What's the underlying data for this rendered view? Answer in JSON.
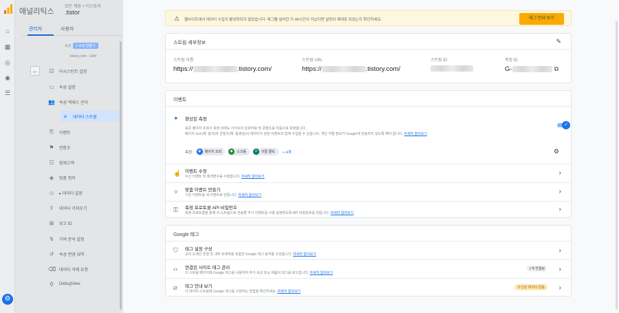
{
  "app": {
    "name": "애널리틱스",
    "account_label": "모든 계정 > 티스토리",
    "property_name": ".tistor"
  },
  "sidebar": {
    "tabs": [
      "관리자",
      "사용자"
    ],
    "create_button": "+ 속성 만들기",
    "property_label": "속성",
    "property_value": "tistory.com - GA4",
    "items": [
      {
        "label": "어시스턴트 설정",
        "icon": "checkbox-icon"
      },
      {
        "label": "속성 설정",
        "icon": "square-icon"
      },
      {
        "label": "속성 액세스 관리",
        "icon": "people-icon"
      },
      {
        "label": "데이터 스트림",
        "icon": "stream-icon",
        "active": true
      },
      {
        "label": "이벤트",
        "icon": "event-icon"
      },
      {
        "label": "전환수",
        "icon": "flag-icon"
      },
      {
        "label": "잠재고객",
        "icon": "audience-icon"
      },
      {
        "label": "맞춤 정의",
        "icon": "custom-icon"
      },
      {
        "label": "▸ 데이터 설정",
        "icon": "layers-icon"
      },
      {
        "label": "데이터 가져오기",
        "icon": "upload-icon"
      },
      {
        "label": "보고 ID",
        "icon": "id-icon"
      },
      {
        "label": "기여 분석 설정",
        "icon": "attribution-icon"
      },
      {
        "label": "속성 변경 내역",
        "icon": "history-icon"
      },
      {
        "label": "데이터 삭제 요청",
        "icon": "delete-icon"
      },
      {
        "label": "DebugView",
        "icon": "debug-icon"
      }
    ]
  },
  "banner": {
    "text": "웹사이트에서 데이터 수집이 활성화되지 않았습니다. 태그를 설치한 지 48시간이 지났다면 설정이 제대로 되었는지 확인하세요.",
    "button": "태그 안내 보기"
  },
  "stream_details": {
    "title": "스트림 세부정보",
    "fields": [
      {
        "key": "스트림 이름",
        "prefix": "https://",
        "suffix": ".tistory.com/"
      },
      {
        "key": "스트림 URL",
        "prefix": "https://",
        "suffix": ".tistory.com/"
      },
      {
        "key": "스트림 ID",
        "prefix": "",
        "suffix": ""
      },
      {
        "key": "측정 ID",
        "prefix": "G-",
        "suffix": ""
      }
    ]
  },
  "events": {
    "title": "이벤트",
    "enhanced": {
      "title": "향상된 측정",
      "desc1": "표준 페이지 조회수 측정 외에도 사이트의 상호작용 및 콘텐츠를 자동으로 측정합니다.",
      "desc2": "페이지 요소(예: 링크)와 콘텐츠(예: 동영상)의 데이터가 관련 이벤트와 함께 수집될 수 있습니다. 개인 식별 정보가 Google에 전송되지 않도록 해야 합니다.",
      "link": "자세히 알아보기",
      "measure_label": "측정:",
      "chips": [
        "페이지 조회",
        "스크롤",
        "이탈 클릭"
      ],
      "more": "+ 4개"
    },
    "rows": [
      {
        "title": "이벤트 수정",
        "desc": "수신 이벤트 및 매개변수를 수정합니다.",
        "link": "자세히 알아보기"
      },
      {
        "title": "맞춤 이벤트 만들기",
        "desc": "기존 이벤트를 새 이벤트로 만듭니다.",
        "link": "자세히 알아보기"
      },
      {
        "title": "측정 프로토콜 API 비밀번호",
        "desc": "측정 프로토콜을 통해 이 스트림으로 전송할 추가 이벤트를 사용 설정하도록 API 비밀번호를 만듭니다.",
        "link": "자세히 알아보기"
      }
    ]
  },
  "google_tag": {
    "title": "Google 태그",
    "rows": [
      {
        "title": "태그 설정 구성",
        "desc": "교차 도메인 연결 및 내부 트래픽을 포함한 Google 태그 동작을 구성합니다.",
        "link": "자세히 알아보기",
        "badge": ""
      },
      {
        "title": "연결된 사이트 태그 관리",
        "desc": "이 스트림 페이지에 Google 태그를 사용하여 추가 속성 또는 제품의 태그를 로드합니다.",
        "link": "자세히 알아보기",
        "badge": "1개 연결됨"
      },
      {
        "title": "태그 안내 보기",
        "desc": "이 데이터 스트림에 Google 태그를 구현하는 방법을 확인하세요.",
        "link": "자세히 알아보기",
        "badge": "수신된 데이터 없음"
      }
    ]
  }
}
